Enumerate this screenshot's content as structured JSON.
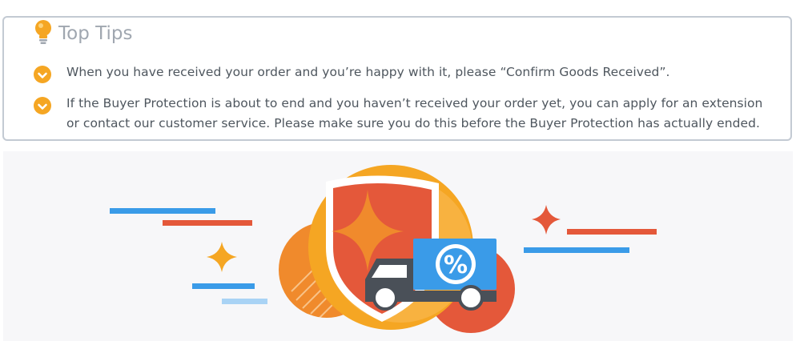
{
  "section": {
    "title": "Top Tips",
    "icon": "lightbulb-icon",
    "accent_color": "#f5a623",
    "border_color": "#c3cad3"
  },
  "tips": [
    {
      "icon": "check-badge-icon",
      "text": "When you have received your order and you’re happy with it, please “Confirm Goods Received”."
    },
    {
      "icon": "check-badge-icon",
      "text": "If the Buyer Protection is about to end and you haven’t received your order yet, you can apply for an extension or contact our customer service. Please make sure you do this before the Buyer Protection has actually ended."
    }
  ],
  "illustration": {
    "icon": "buyer-protection-truck-illustration",
    "badge_symbol": "%"
  }
}
